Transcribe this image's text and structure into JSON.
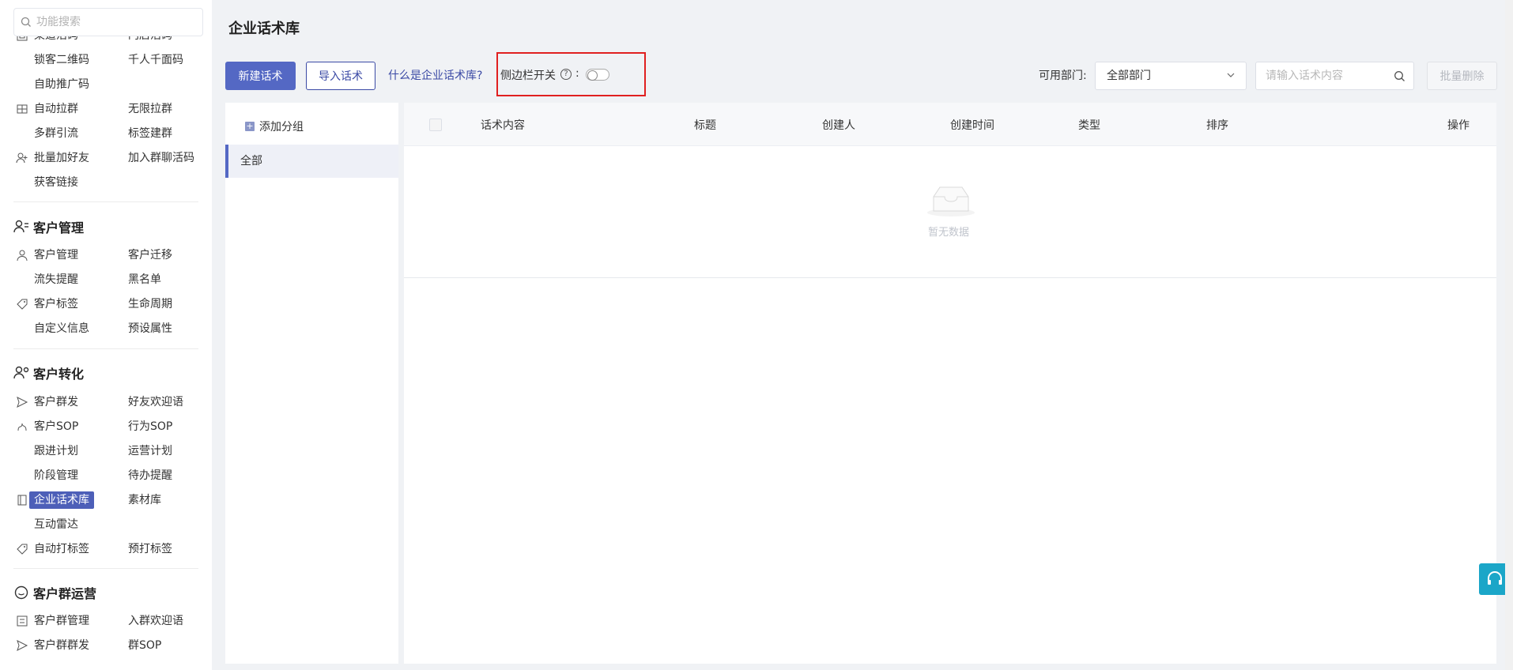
{
  "sidebar": {
    "search_placeholder": "功能搜索",
    "partial_row": {
      "c1": "渠道活码",
      "c2": "门店活码"
    },
    "rows1": [
      {
        "c1": "锁客二维码",
        "c2": "千人千面码"
      },
      {
        "c1": "自助推广码",
        "c2": ""
      },
      {
        "c1": "自动拉群",
        "c2": "无限拉群"
      },
      {
        "c1": "多群引流",
        "c2": "标签建群"
      },
      {
        "c1": "批量加好友",
        "c2": "加入群聊活码"
      },
      {
        "c1": "获客链接",
        "c2": ""
      }
    ],
    "section_customer_mgmt": "客户管理",
    "rows2": [
      {
        "c1": "客户管理",
        "c2": "客户迁移"
      },
      {
        "c1": "流失提醒",
        "c2": "黑名单"
      },
      {
        "c1": "客户标签",
        "c2": "生命周期"
      },
      {
        "c1": "自定义信息",
        "c2": "预设属性"
      }
    ],
    "section_customer_conv": "客户转化",
    "rows3": [
      {
        "c1": "客户群发",
        "c2": "好友欢迎语"
      },
      {
        "c1": "客户SOP",
        "c2": "行为SOP"
      },
      {
        "c1": "跟进计划",
        "c2": "运营计划"
      },
      {
        "c1": "阶段管理",
        "c2": "待办提醒"
      },
      {
        "c1": "企业话术库",
        "c2": "素材库"
      },
      {
        "c1": "互动雷达",
        "c2": ""
      },
      {
        "c1": "自动打标签",
        "c2": "预打标签"
      }
    ],
    "section_group_ops": "客户群运营",
    "rows4": [
      {
        "c1": "客户群管理",
        "c2": "入群欢迎语"
      },
      {
        "c1": "客户群群发",
        "c2": "群SOP"
      }
    ]
  },
  "page": {
    "title": "企业话术库"
  },
  "toolbar": {
    "new_label": "新建话术",
    "import_label": "导入话术",
    "help_link": "什么是企业话术库?",
    "sidebar_switch_label": "侧边栏开关",
    "sidebar_switch_on": false,
    "dept_label": "可用部门:",
    "dept_value": "全部部门",
    "search_placeholder": "请输入话术内容",
    "batch_delete_label": "批量删除"
  },
  "groups": {
    "add_label": "添加分组",
    "items": [
      "全部"
    ]
  },
  "table": {
    "columns": [
      "话术内容",
      "标题",
      "创建人",
      "创建时间",
      "类型",
      "排序",
      "操作"
    ],
    "rows": [],
    "empty_text": "暂无数据"
  },
  "colors": {
    "primary": "#5468c4",
    "highlight_box": "#e02020",
    "support_button": "#1ba6c8"
  }
}
